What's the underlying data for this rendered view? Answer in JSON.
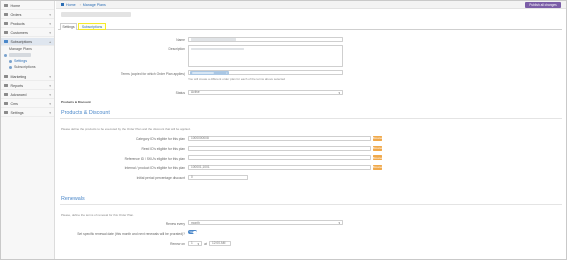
{
  "sidebar": {
    "items": [
      {
        "label": "Home",
        "icon": "home-icon"
      },
      {
        "label": "Orders",
        "icon": "cart-icon"
      },
      {
        "label": "Products",
        "icon": "box-icon"
      },
      {
        "label": "Customers",
        "icon": "user-icon"
      },
      {
        "label": "Subscriptions",
        "icon": "refresh-icon"
      },
      {
        "label": "Manage Plans",
        "icon": ""
      },
      {
        "label": "Settings",
        "icon": "gear-icon"
      },
      {
        "label": "Subscriptions",
        "icon": "list-icon"
      },
      {
        "label": "Marketing",
        "icon": "megaphone-icon"
      },
      {
        "label": "Reports",
        "icon": "chart-icon"
      },
      {
        "label": "Advanced",
        "icon": "code-icon"
      },
      {
        "label": "Cms",
        "icon": "page-icon"
      },
      {
        "label": "Settings",
        "icon": "gear-icon"
      }
    ]
  },
  "topbar": {
    "breadcrumb_home": "Home",
    "breadcrumb_current": "Manage Plans",
    "publish_label": "Publish all changes"
  },
  "tabs": {
    "settings": "Settings",
    "subscriptions": "Subscriptions"
  },
  "form": {
    "name_label": "Name",
    "description_label": "Description",
    "terms_label": "Terms (copied for which Order Plan applies)",
    "terms_help": "You will create a different order plan for each of the terms above selected",
    "status_label": "Status",
    "status_value": "Active",
    "products_discount_small": "Products & Discount"
  },
  "products": {
    "heading": "Products & Discount",
    "help": "Please define the products to be executed by the Order Plan and the discount that will be applied.",
    "category_label": "Category ID's eligible for this plan",
    "category_value": "1000000008",
    "reed_label": "Reed ID's eligible for this plan",
    "reference_label": "Reference ID / SKU's eligible for this plan",
    "internal_label": "Internal / product ID's eligible for this plan",
    "internal_value": "100001,1001",
    "initial_label": "Initial period percentage discount",
    "initial_value": "0",
    "browse_label": "Browse"
  },
  "renewals": {
    "heading": "Renewals",
    "help": "Please, define the terms of renewal for this Order Plan.",
    "renew_label": "Renew every",
    "renew_value": "month",
    "specific_label": "Set specific renewal date (this month and next renewals will be prorated)?",
    "toggle_label": "YES",
    "renew_on_label": "Renew on",
    "renew_on_day": "1",
    "renew_on_at": "at",
    "renew_on_time": "12:00 AM"
  },
  "colors": {
    "accent": "#4a87c9",
    "publish": "#7b5ea7",
    "highlight": "#f5ea2a",
    "browse": "#f0a94b"
  }
}
